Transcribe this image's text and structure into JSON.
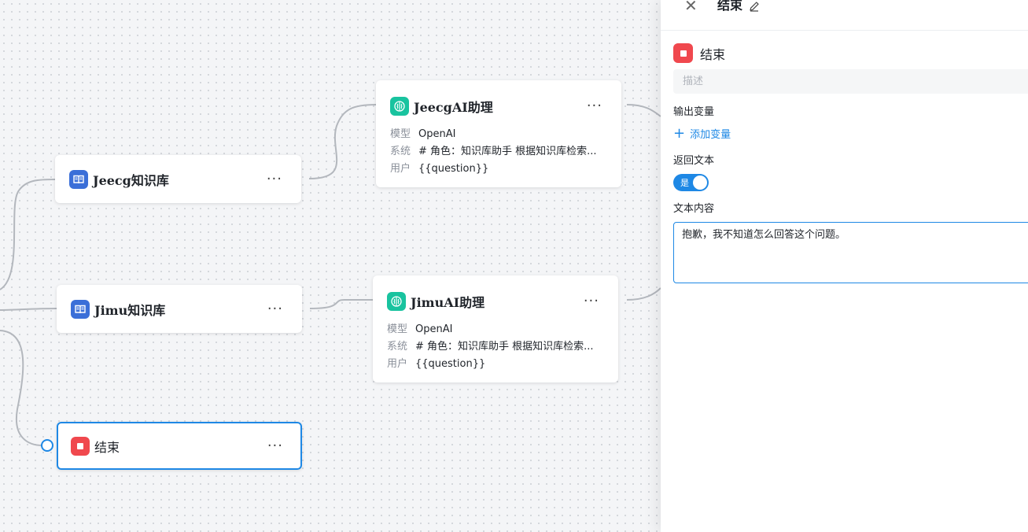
{
  "canvas": {
    "nodes": {
      "jeecg_kb": {
        "title": "Jeecg知识库",
        "icon": "book-icon",
        "menu": "···"
      },
      "jimu_kb": {
        "title": "Jimu知识库",
        "icon": "book-icon",
        "menu": "···"
      },
      "jeecg_ai": {
        "title": "JeecgAI助理",
        "icon": "brain-icon",
        "menu": "···",
        "rows": [
          {
            "key": "模型",
            "value": "OpenAI"
          },
          {
            "key": "系统",
            "value": "# 角色：知识库助手 根据知识库检索..."
          },
          {
            "key": "用户",
            "value": "{{question}}"
          }
        ]
      },
      "jimu_ai": {
        "title": "JimuAI助理",
        "icon": "brain-icon",
        "menu": "···",
        "rows": [
          {
            "key": "模型",
            "value": "OpenAI"
          },
          {
            "key": "系统",
            "value": "# 角色：知识库助手 根据知识库检索..."
          },
          {
            "key": "用户",
            "value": "{{question}}"
          }
        ]
      },
      "end": {
        "title": "结束",
        "icon": "stop-icon",
        "menu": "···"
      }
    }
  },
  "panel": {
    "title": "结束",
    "close_glyph": "✕",
    "node_name": "结束",
    "desc_placeholder": "描述",
    "output_vars_label": "输出变量",
    "add_var_plus": "+",
    "add_var_label": "添加变量",
    "return_text_label": "返回文本",
    "toggle_label": "是",
    "toggle_on": true,
    "text_content_label": "文本内容",
    "text_content_value": "抱歉，我不知道怎么回答这个问题。"
  },
  "colors": {
    "accent": "#1e88e5",
    "kb_icon": "#3b6fd8",
    "ai_icon": "#19c39f",
    "end_icon": "#f0484e"
  }
}
